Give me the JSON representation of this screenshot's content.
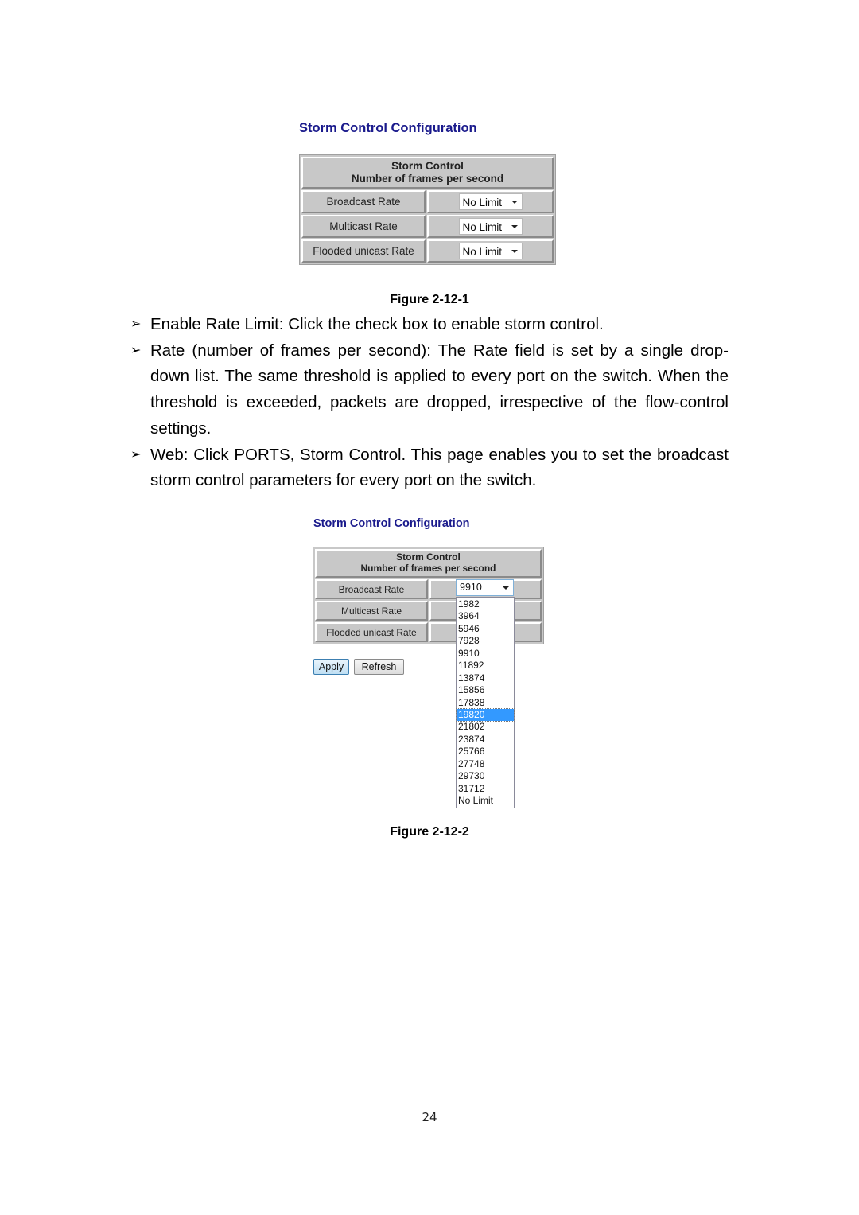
{
  "figure1": {
    "title": "Storm Control Configuration",
    "header_line1": "Storm Control",
    "header_line2": "Number of frames per second",
    "rows": [
      {
        "label": "Broadcast Rate",
        "value": "No Limit"
      },
      {
        "label": "Multicast Rate",
        "value": "No Limit"
      },
      {
        "label": "Flooded unicast Rate",
        "value": "No Limit"
      }
    ],
    "caption": "Figure 2-12-1"
  },
  "bullets": [
    {
      "marker": "➢",
      "text": "Enable Rate Limit: Click the check box to enable storm control."
    },
    {
      "marker": "➢",
      "text": "Rate (number of frames per second): The Rate field is set by a single drop-down list. The same threshold is applied to every port on the switch. When the threshold is exceeded, packets are dropped, irrespective of the flow-control settings."
    },
    {
      "marker": "➢",
      "text": "Web: Click PORTS, Storm Control. This page enables you to set the broadcast storm control parameters for every port on the switch."
    }
  ],
  "figure2": {
    "title": "Storm Control Configuration",
    "header_line1": "Storm Control",
    "header_line2": "Number of frames per second",
    "rows": [
      {
        "label": "Broadcast Rate"
      },
      {
        "label": "Multicast Rate"
      },
      {
        "label": "Flooded unicast Rate"
      }
    ],
    "broadcast_select_value": "9910",
    "dropdown_options": [
      "1982",
      "3964",
      "5946",
      "7928",
      "9910",
      "11892",
      "13874",
      "15856",
      "17838",
      "19820",
      "21802",
      "23874",
      "25766",
      "27748",
      "29730",
      "31712",
      "No Limit"
    ],
    "highlighted_option": "19820",
    "apply_label": "Apply",
    "refresh_label": "Refresh",
    "caption": "Figure 2-12-2"
  },
  "page_number": "24"
}
